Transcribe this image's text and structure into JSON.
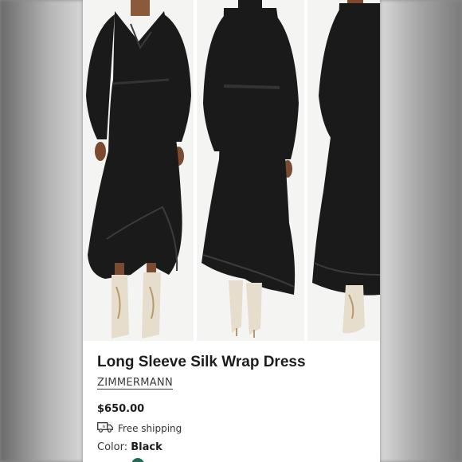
{
  "product": {
    "title": "Long Sleeve Silk Wrap Dress",
    "brand": "ZIMMERMANN",
    "price": "$650.00",
    "shipping_label": "Free shipping",
    "color_label": "Color:",
    "color_value": "Black"
  },
  "colors": {
    "dress": "#1a1a1a",
    "boot": "#e6ddcc",
    "photo_bg": "#f4f4f3",
    "swatch_peek": "#1f6b55"
  },
  "gallery": {
    "images": [
      "front-view",
      "back-view",
      "side-view"
    ]
  }
}
